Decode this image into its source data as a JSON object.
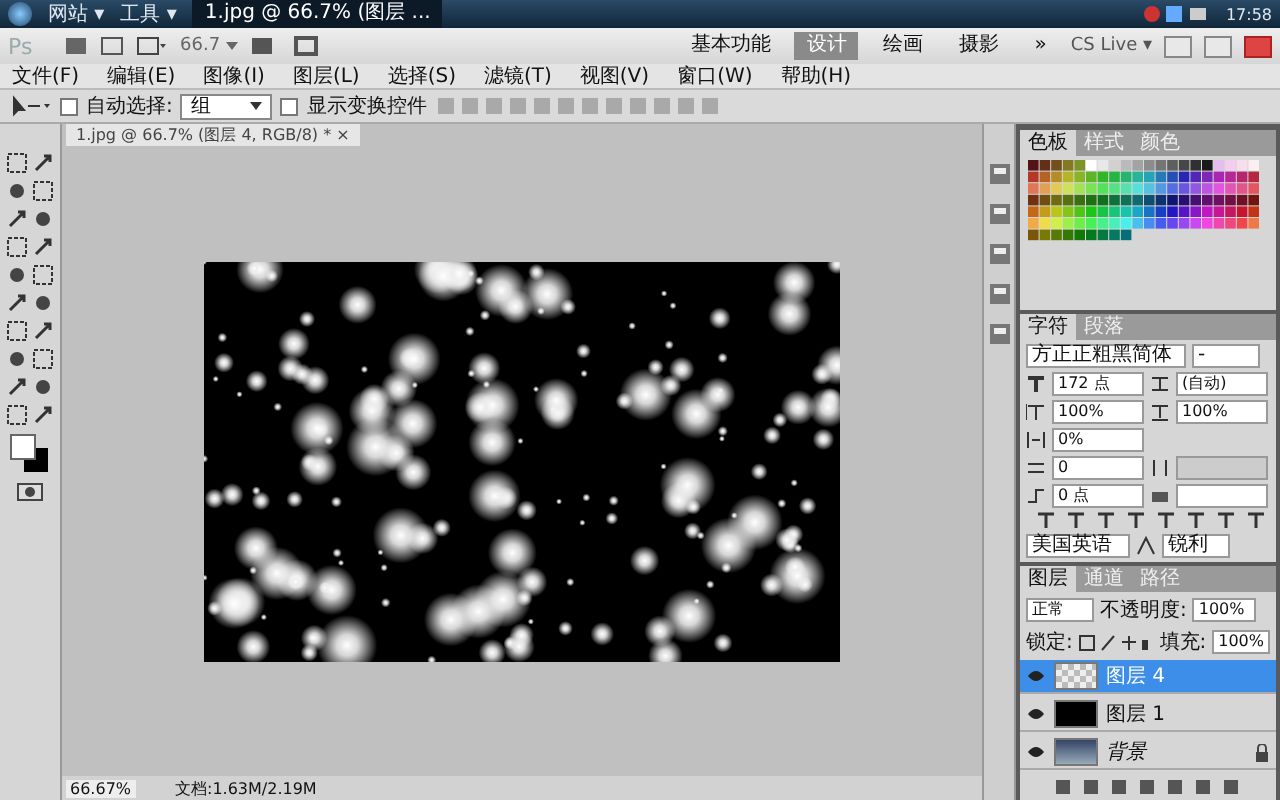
{
  "taskbar": {
    "menus": [
      "网站 ▾",
      "工具 ▾"
    ],
    "document_tab": "1.jpg @ 66.7% (图层 ...",
    "clock": "17:58"
  },
  "app_bar": {
    "logo": "Ps",
    "zoom": "66.7",
    "workspaces": [
      {
        "label": "基本功能",
        "selected": false
      },
      {
        "label": "设计",
        "selected": true
      },
      {
        "label": "绘画",
        "selected": false
      },
      {
        "label": "摄影",
        "selected": false
      }
    ],
    "more": "»",
    "cs_live": "CS Live ▾"
  },
  "menu": [
    "文件(F)",
    "编辑(E)",
    "图像(I)",
    "图层(L)",
    "选择(S)",
    "滤镜(T)",
    "视图(V)",
    "窗口(W)",
    "帮助(H)"
  ],
  "options_bar": {
    "auto_select": {
      "label": "自动选择:",
      "checked": false,
      "value": "组"
    },
    "show_transform": {
      "label": "显示变换控件",
      "checked": false
    }
  },
  "document": {
    "tab": "1.jpg @ 66.7% (图层 4, RGB/8) *",
    "close": "×"
  },
  "status_bar": {
    "zoom": "66.67%",
    "doc_size": "文档:1.63M/2.19M"
  },
  "swatches_panel": {
    "tabs": [
      {
        "label": "色板",
        "selected": true
      },
      {
        "label": "样式",
        "selected": false
      },
      {
        "label": "颜色",
        "selected": false
      }
    ]
  },
  "character_panel": {
    "tabs": [
      {
        "label": "字符",
        "selected": true
      },
      {
        "label": "段落",
        "selected": false
      }
    ],
    "font_family": "方正正粗黑简体",
    "font_style": "-",
    "size": "172 点",
    "leading": "(自动)",
    "vertical_scale": "100%",
    "horizontal_scale": "100%",
    "tsume": "0%",
    "tracking": "0",
    "baseline_shift": "0 点",
    "language": "美国英语",
    "antialias": "锐利"
  },
  "layers_panel": {
    "tabs": [
      {
        "label": "图层",
        "selected": true
      },
      {
        "label": "通道",
        "selected": false
      },
      {
        "label": "路径",
        "selected": false
      }
    ],
    "blend_mode": "正常",
    "opacity_label": "不透明度:",
    "opacity": "100%",
    "lock_label": "锁定:",
    "fill_label": "填充:",
    "fill": "100%",
    "layers": [
      {
        "name": "图层 4",
        "kind": "transparent",
        "selected": true,
        "visible": true,
        "locked": false
      },
      {
        "name": "图层 1",
        "kind": "black",
        "selected": false,
        "visible": true,
        "locked": false
      },
      {
        "name": "背景",
        "kind": "photo",
        "selected": false,
        "visible": true,
        "locked": true
      }
    ]
  }
}
